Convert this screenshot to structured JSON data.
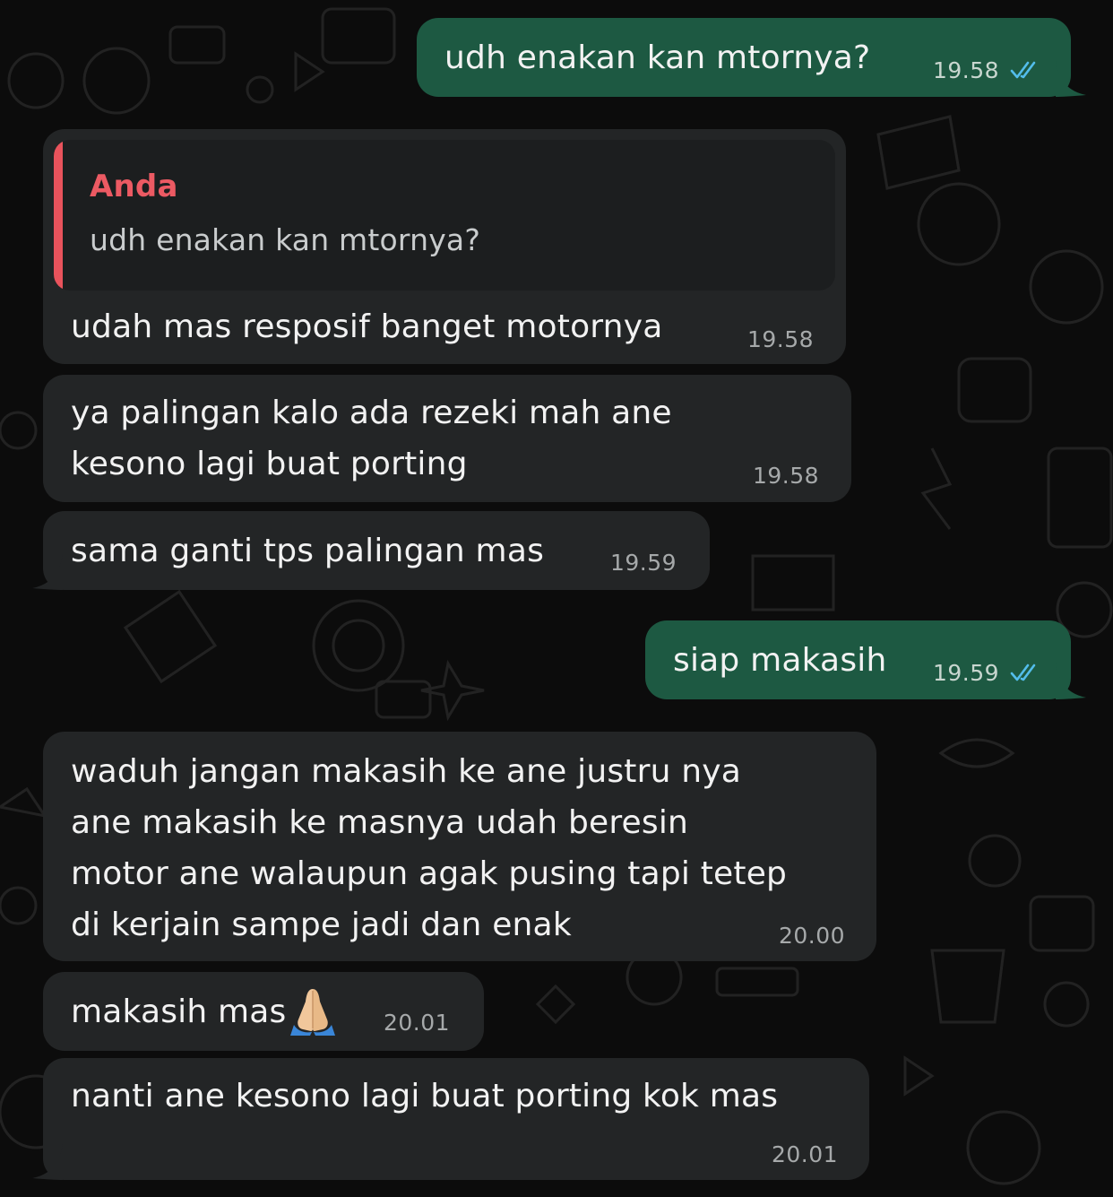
{
  "chat": {
    "messages": [
      {
        "id": "m1",
        "direction": "outgoing",
        "text": "udh enakan kan mtornya?",
        "time": "19.58",
        "status": "read"
      },
      {
        "id": "m2",
        "direction": "incoming",
        "reply_to": {
          "author": "Anda",
          "text": "udh enakan kan mtornya?"
        },
        "text": "udah mas resposif banget motornya",
        "time": "19.58"
      },
      {
        "id": "m3",
        "direction": "incoming",
        "lines": [
          "ya palingan kalo ada rezeki mah ane",
          "kesono lagi buat porting"
        ],
        "time": "19.58"
      },
      {
        "id": "m4",
        "direction": "incoming",
        "text": "sama ganti tps palingan mas",
        "time": "19.59"
      },
      {
        "id": "m5",
        "direction": "outgoing",
        "text": "siap makasih",
        "time": "19.59",
        "status": "read"
      },
      {
        "id": "m6",
        "direction": "incoming",
        "lines": [
          "waduh jangan makasih ke ane justru nya",
          "ane makasih ke masnya udah beresin",
          "motor ane walaupun agak pusing tapi tetep",
          "di kerjain sampe jadi dan enak"
        ],
        "time": "20.00"
      },
      {
        "id": "m7",
        "direction": "incoming",
        "text": "makasih mas",
        "emoji": "folded-hands-emoji",
        "time": "20.01"
      },
      {
        "id": "m8",
        "direction": "incoming",
        "text": "nanti ane kesono lagi buat porting kok mas",
        "time": "20.01"
      }
    ]
  },
  "colors": {
    "background": "#0c0c0c",
    "incoming_bubble": "#232526",
    "outgoing_bubble": "#1d5942",
    "quote_accent": "#e9535c",
    "read_ticks": "#53bdeb",
    "timestamp": "#a6a9aa"
  },
  "icons": {
    "read_receipt": "double-check-icon",
    "emoji": "folded-hands-emoji"
  }
}
